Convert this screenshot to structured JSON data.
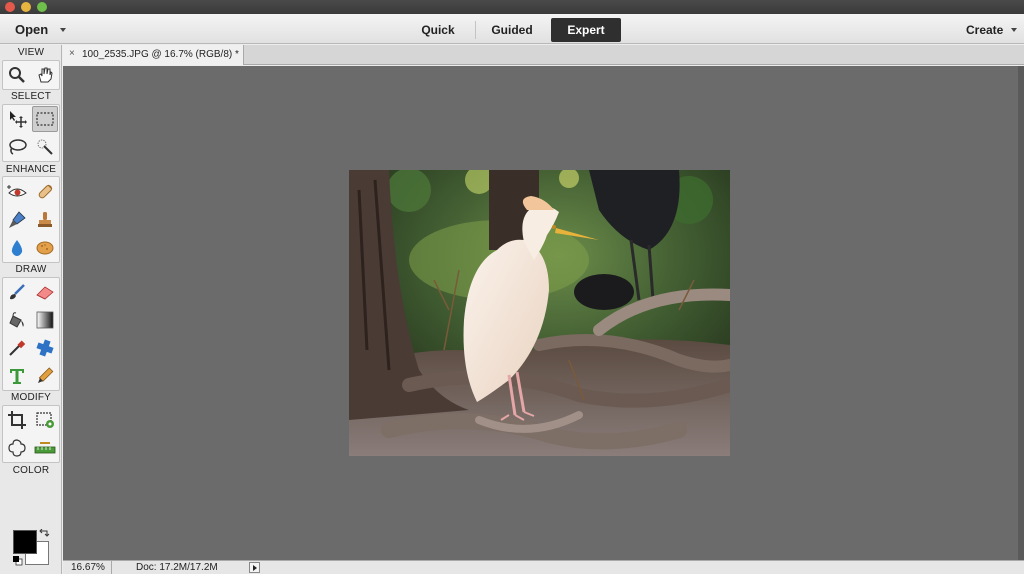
{
  "menubar": {
    "open_label": "Open",
    "modes": [
      {
        "label": "Quick",
        "active": false
      },
      {
        "label": "Guided",
        "active": false
      },
      {
        "label": "Expert",
        "active": true
      }
    ],
    "create_label": "Create"
  },
  "toolbox": {
    "sections": {
      "view": "VIEW",
      "select": "SELECT",
      "enhance": "ENHANCE",
      "draw": "DRAW",
      "modify": "MODIFY",
      "color": "COLOR"
    },
    "tools": {
      "view": [
        "zoom-icon",
        "hand-icon"
      ],
      "select": [
        "move-icon",
        "rectangular-marquee-icon",
        "lasso-icon",
        "quick-selection-icon"
      ],
      "enhance": [
        "red-eye-icon",
        "spot-healing-icon",
        "smart-brush-icon",
        "clone-stamp-icon",
        "blur-icon",
        "sponge-icon"
      ],
      "draw": [
        "brush-icon",
        "eraser-icon",
        "paint-bucket-icon",
        "gradient-icon",
        "color-picker-icon",
        "custom-shape-icon",
        "type-icon",
        "pencil-icon"
      ],
      "modify": [
        "crop-icon",
        "recompose-icon",
        "content-aware-move-icon",
        "straighten-icon"
      ]
    },
    "selected_tool": "rectangular-marquee-icon",
    "foreground_color": "#000000",
    "background_color": "#ffffff"
  },
  "document": {
    "tab_close": "×",
    "tab_title": "100_2535.JPG @ 16.7% (RGB/8) *"
  },
  "status": {
    "zoom": "16.67%",
    "doc_size": "Doc: 17.2M/17.2M"
  }
}
